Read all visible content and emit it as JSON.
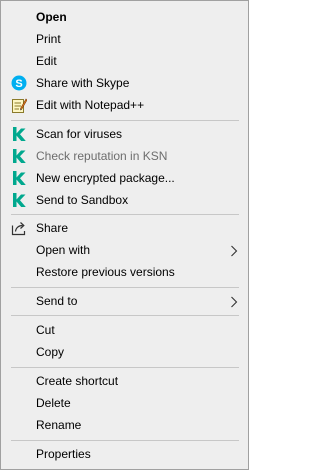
{
  "menu": {
    "items": {
      "open": "Open",
      "print": "Print",
      "edit": "Edit",
      "share_skype": "Share with Skype",
      "edit_notepad": "Edit with Notepad++",
      "scan_viruses": "Scan for viruses",
      "check_reputation": "Check reputation in KSN",
      "new_encrypted": "New encrypted package...",
      "send_sandbox": "Send to Sandbox",
      "share": "Share",
      "open_with": "Open with",
      "restore_previous": "Restore previous versions",
      "send_to": "Send to",
      "cut": "Cut",
      "copy": "Copy",
      "create_shortcut": "Create shortcut",
      "delete": "Delete",
      "rename": "Rename",
      "properties": "Properties"
    },
    "icons": {
      "skype": "skype-icon",
      "notepad": "notepad-icon",
      "kaspersky": "kaspersky-icon",
      "share": "share-icon",
      "submenu": "chevron-right-icon"
    },
    "colors": {
      "background": "#eeeeee",
      "border": "#a0a0a0",
      "separator": "#c7c7c7",
      "text": "#000000",
      "disabled_text": "#6d6d6d",
      "skype_blue": "#00aff0",
      "kaspersky_green": "#00a88e"
    }
  }
}
